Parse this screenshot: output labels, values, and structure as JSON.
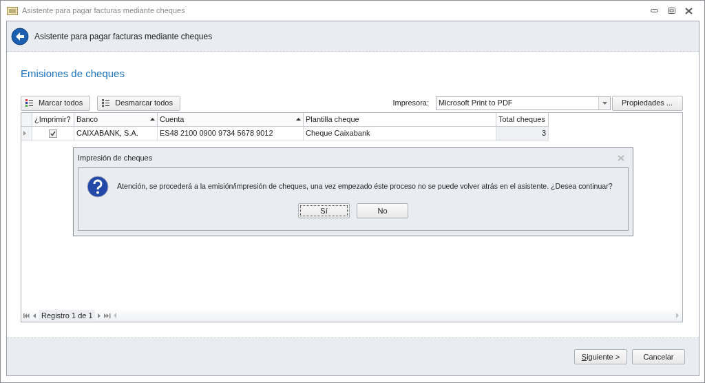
{
  "window": {
    "title": "Asistente para pagar facturas mediante cheques"
  },
  "header": {
    "title": "Asistente para pagar facturas mediante cheques"
  },
  "section_title": "Emisiones de cheques",
  "toolbar": {
    "buttons": [
      {
        "label": "Marcar todos",
        "kind": "mark"
      },
      {
        "label": "Desmarcar todos",
        "kind": "unmark"
      }
    ],
    "printer_label": "Impresora:",
    "printer_value": "Microsoft Print to PDF",
    "properties_button": "Propiedades ..."
  },
  "grid": {
    "columns": [
      {
        "label": "¿Imprimir?",
        "sorted": false
      },
      {
        "label": "Banco",
        "sorted": true
      },
      {
        "label": "Cuenta",
        "sorted": true
      },
      {
        "label": "Plantilla cheque",
        "sorted": false
      },
      {
        "label": "Total cheques",
        "sorted": false
      }
    ],
    "rows": [
      {
        "selected": true,
        "print": true,
        "bank": "CAIXABANK, S.A.",
        "account": "ES48 2100 0900 9734 5678 9012",
        "template": "Cheque Caixabank",
        "total": "3"
      }
    ],
    "navigator": "Registro 1 de 1"
  },
  "dialog": {
    "title": "Impresión de cheques",
    "message": "Atención, se procederá a la emisión/impresión de cheques, una vez empezado éste proceso no se puede volver atrás en el asistente. ¿Desea continuar?",
    "buttons": [
      {
        "label": "Sí",
        "focused": true
      },
      {
        "label": "No",
        "focused": false
      }
    ]
  },
  "footer": {
    "buttons": [
      {
        "label": "Siguiente >",
        "mnemonic": true
      },
      {
        "label": "Cancelar",
        "mnemonic": false
      }
    ]
  }
}
